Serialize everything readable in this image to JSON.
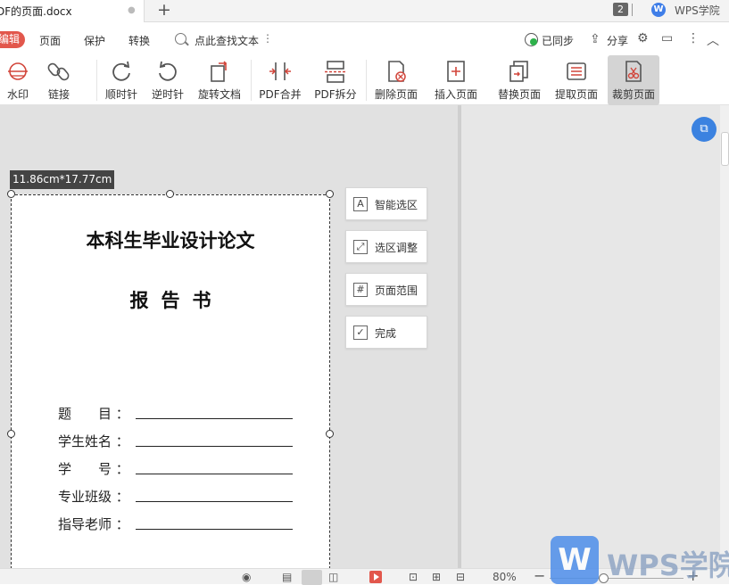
{
  "tabbar": {
    "document_tab": "DF的页面.docx",
    "tab_count": "2",
    "academy_label": "WPS学院"
  },
  "menubar": {
    "edit_pill": "编辑",
    "items": [
      "页面",
      "保护",
      "转换"
    ],
    "search_label": "点此查找文本",
    "sync_label": "已同步",
    "share_label": "分享"
  },
  "toolbar": {
    "tools": [
      {
        "id": "watermark",
        "label": "水印",
        "icon": "watermark-icon"
      },
      {
        "id": "link",
        "label": "链接",
        "icon": "link-icon"
      },
      {
        "id": "rotate-cw",
        "label": "顺时针",
        "icon": "rotate-clockwise-icon"
      },
      {
        "id": "rotate-ccw",
        "label": "逆时针",
        "icon": "rotate-counterclockwise-icon"
      },
      {
        "id": "rotate-doc",
        "label": "旋转文档",
        "icon": "rotate-document-icon"
      },
      {
        "id": "pdf-merge",
        "label": "PDF合并",
        "icon": "pdf-merge-icon"
      },
      {
        "id": "pdf-split",
        "label": "PDF拆分",
        "icon": "pdf-split-icon"
      },
      {
        "id": "delete-page",
        "label": "删除页面",
        "icon": "delete-page-icon"
      },
      {
        "id": "insert-page",
        "label": "插入页面",
        "icon": "insert-page-icon"
      },
      {
        "id": "replace-page",
        "label": "替换页面",
        "icon": "replace-page-icon"
      },
      {
        "id": "extract-page",
        "label": "提取页面",
        "icon": "extract-page-icon"
      },
      {
        "id": "crop-page",
        "label": "裁剪页面",
        "icon": "crop-page-icon"
      }
    ]
  },
  "crop": {
    "size_label": "11.86cm*17.77cm"
  },
  "document": {
    "title": "本科生毕业设计论文",
    "subtitle": "报告书",
    "fields": [
      {
        "label": "题　　目 ：",
        "value": ""
      },
      {
        "label": "学生姓名 ：",
        "value": ""
      },
      {
        "label": "学　　号 ：",
        "value": ""
      },
      {
        "label": "专业班级 ：",
        "value": ""
      },
      {
        "label": "指导老师 ：",
        "value": ""
      }
    ]
  },
  "crop_panel": {
    "buttons": [
      {
        "label": "智能选区",
        "icon": "smart-select-icon"
      },
      {
        "label": "选区调整",
        "icon": "adjust-selection-icon"
      },
      {
        "label": "页面范围",
        "icon": "page-range-icon"
      },
      {
        "label": "完成",
        "icon": "done-icon"
      }
    ]
  },
  "statusbar": {
    "zoom_label": "80%"
  },
  "watermark": {
    "text": "WPS学院"
  },
  "colors": {
    "accent_red": "#e2574c",
    "accent_blue": "#3b82e0",
    "sync_green": "#2db14a"
  }
}
